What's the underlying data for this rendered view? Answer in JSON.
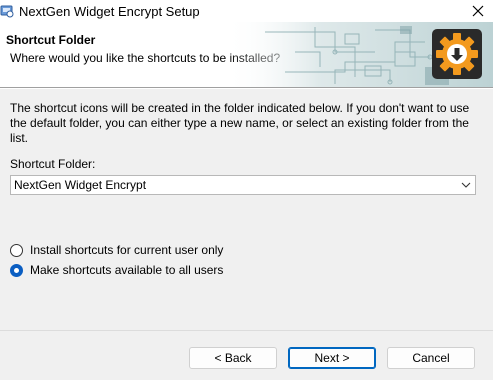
{
  "window": {
    "title": "NextGen Widget Encrypt Setup"
  },
  "header": {
    "title": "Shortcut Folder",
    "subtitle": "Where would you like the shortcuts to be installed?"
  },
  "body": {
    "intro": "The shortcut icons will be created in the folder indicated below. If you don't want to use the default folder, you can either type a new name, or select an existing folder from the list.",
    "folder_label": "Shortcut Folder:",
    "folder_value": "NextGen Widget Encrypt"
  },
  "options": [
    {
      "label": "Install shortcuts for current user only",
      "selected": false
    },
    {
      "label": "Make shortcuts available to all users",
      "selected": true
    }
  ],
  "buttons": {
    "back": "< Back",
    "next": "Next >",
    "cancel": "Cancel"
  },
  "icons": {
    "app": "installer-icon",
    "close": "close-icon",
    "logo": "gear-download-icon",
    "dropdown": "chevron-down-icon"
  },
  "colors": {
    "accent": "#0067c0",
    "logo_orange": "#f39a1e",
    "logo_dark": "#2a2a2a"
  }
}
